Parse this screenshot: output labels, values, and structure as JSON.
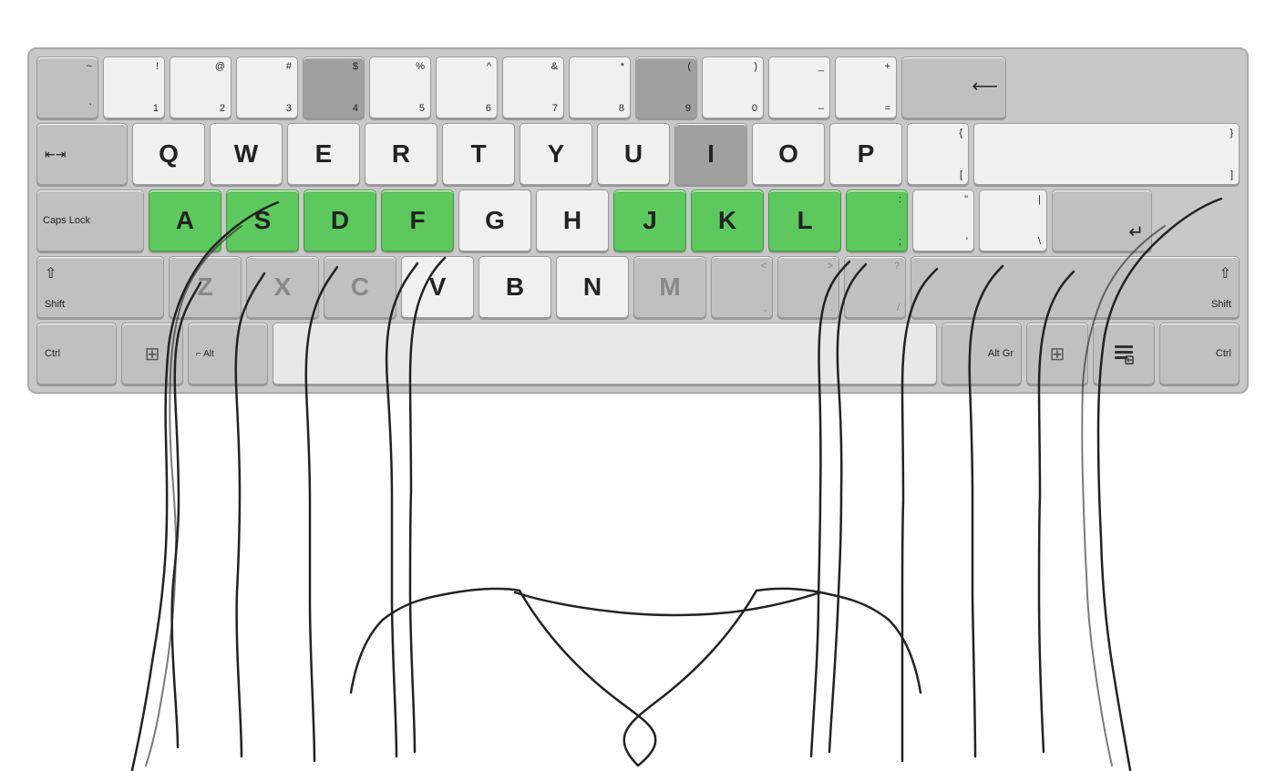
{
  "keyboard": {
    "rows": [
      {
        "id": "number-row",
        "keys": [
          {
            "id": "tilde",
            "upper": "~",
            "lower": "`",
            "style": "gray"
          },
          {
            "id": "1",
            "upper": "!",
            "lower": "1",
            "style": "normal"
          },
          {
            "id": "2",
            "upper": "@",
            "lower": "2",
            "style": "normal"
          },
          {
            "id": "3",
            "upper": "#",
            "lower": "3",
            "style": "normal"
          },
          {
            "id": "4",
            "upper": "$",
            "lower": "4",
            "style": "dark"
          },
          {
            "id": "5",
            "upper": "%",
            "lower": "5",
            "style": "normal"
          },
          {
            "id": "6",
            "upper": "^",
            "lower": "6",
            "style": "normal"
          },
          {
            "id": "7",
            "upper": "&",
            "lower": "7",
            "style": "normal"
          },
          {
            "id": "8",
            "upper": "*",
            "lower": "8",
            "style": "normal"
          },
          {
            "id": "9",
            "upper": "(",
            "lower": "9",
            "style": "dark"
          },
          {
            "id": "0",
            "upper": ")",
            "lower": "0",
            "style": "normal"
          },
          {
            "id": "minus",
            "upper": "_",
            "lower": "-",
            "style": "normal"
          },
          {
            "id": "equals",
            "upper": "+",
            "lower": "=",
            "style": "normal"
          },
          {
            "id": "backspace",
            "label": "⟵",
            "style": "wide-gray"
          }
        ]
      },
      {
        "id": "qwerty-row",
        "keys": [
          {
            "id": "tab",
            "label": "⇥",
            "style": "tab-gray"
          },
          {
            "id": "q",
            "main": "Q",
            "style": "normal"
          },
          {
            "id": "w",
            "main": "W",
            "style": "normal"
          },
          {
            "id": "e",
            "main": "E",
            "style": "normal"
          },
          {
            "id": "r",
            "main": "R",
            "style": "normal"
          },
          {
            "id": "t",
            "main": "T",
            "style": "normal"
          },
          {
            "id": "y",
            "main": "Y",
            "style": "normal"
          },
          {
            "id": "u",
            "main": "U",
            "style": "normal"
          },
          {
            "id": "i",
            "main": "I",
            "style": "dark"
          },
          {
            "id": "o",
            "main": "O",
            "style": "normal"
          },
          {
            "id": "p",
            "main": "P",
            "style": "normal"
          },
          {
            "id": "lbracket",
            "upper": "{",
            "lower": "[",
            "style": "normal"
          },
          {
            "id": "rbracket",
            "upper": "}",
            "lower": "]",
            "style": "normal"
          }
        ]
      },
      {
        "id": "home-row",
        "keys": [
          {
            "id": "caps",
            "label": "Caps Lock",
            "style": "caps-gray"
          },
          {
            "id": "a",
            "main": "A",
            "style": "green"
          },
          {
            "id": "s",
            "main": "S",
            "style": "green"
          },
          {
            "id": "d",
            "main": "D",
            "style": "green"
          },
          {
            "id": "f",
            "main": "F",
            "style": "green"
          },
          {
            "id": "g",
            "main": "G",
            "style": "normal"
          },
          {
            "id": "h",
            "main": "H",
            "style": "normal"
          },
          {
            "id": "j",
            "main": "J",
            "style": "green"
          },
          {
            "id": "k",
            "main": "K",
            "style": "green"
          },
          {
            "id": "l",
            "main": "L",
            "style": "green"
          },
          {
            "id": "semicolon",
            "upper": ":",
            "lower": ";",
            "style": "green"
          },
          {
            "id": "quote",
            "upper": "\"",
            "lower": "'",
            "style": "normal"
          },
          {
            "id": "backslash",
            "upper": "|",
            "lower": "\\",
            "style": "normal"
          },
          {
            "id": "enter",
            "label": "↵",
            "style": "enter-gray"
          }
        ]
      },
      {
        "id": "shift-row",
        "keys": [
          {
            "id": "shift-l",
            "label": "⇧ Shift",
            "style": "shift-gray"
          },
          {
            "id": "z",
            "main": "Z",
            "style": "gray"
          },
          {
            "id": "x",
            "main": "X",
            "style": "gray"
          },
          {
            "id": "c",
            "main": "C",
            "style": "gray"
          },
          {
            "id": "v",
            "main": "V",
            "style": "normal"
          },
          {
            "id": "b",
            "main": "B",
            "style": "normal"
          },
          {
            "id": "n",
            "main": "N",
            "style": "normal"
          },
          {
            "id": "m",
            "main": "M",
            "style": "gray"
          },
          {
            "id": "comma",
            "upper": "<",
            "lower": ",",
            "style": "gray"
          },
          {
            "id": "period",
            "upper": ">",
            "lower": ".",
            "style": "gray"
          },
          {
            "id": "slash",
            "upper": "?",
            "lower": "/",
            "style": "gray"
          },
          {
            "id": "shift-r",
            "label": "⇧ Shift",
            "style": "shift-gray"
          }
        ]
      },
      {
        "id": "bottom-row",
        "keys": [
          {
            "id": "ctrl-l",
            "label": "Ctrl",
            "style": "ctrl-gray"
          },
          {
            "id": "win-l",
            "label": "⊞",
            "style": "win-gray"
          },
          {
            "id": "alt-l",
            "label": "Alt",
            "style": "alt-gray"
          },
          {
            "id": "space",
            "label": "",
            "style": "space"
          },
          {
            "id": "alt-gr",
            "label": "Alt Gr",
            "style": "alt-gray"
          },
          {
            "id": "win-r",
            "label": "⊞",
            "style": "win-gray"
          },
          {
            "id": "menu",
            "label": "≣",
            "style": "win-gray"
          },
          {
            "id": "ctrl-r",
            "label": "Ctrl",
            "style": "ctrl-gray"
          }
        ]
      }
    ]
  }
}
